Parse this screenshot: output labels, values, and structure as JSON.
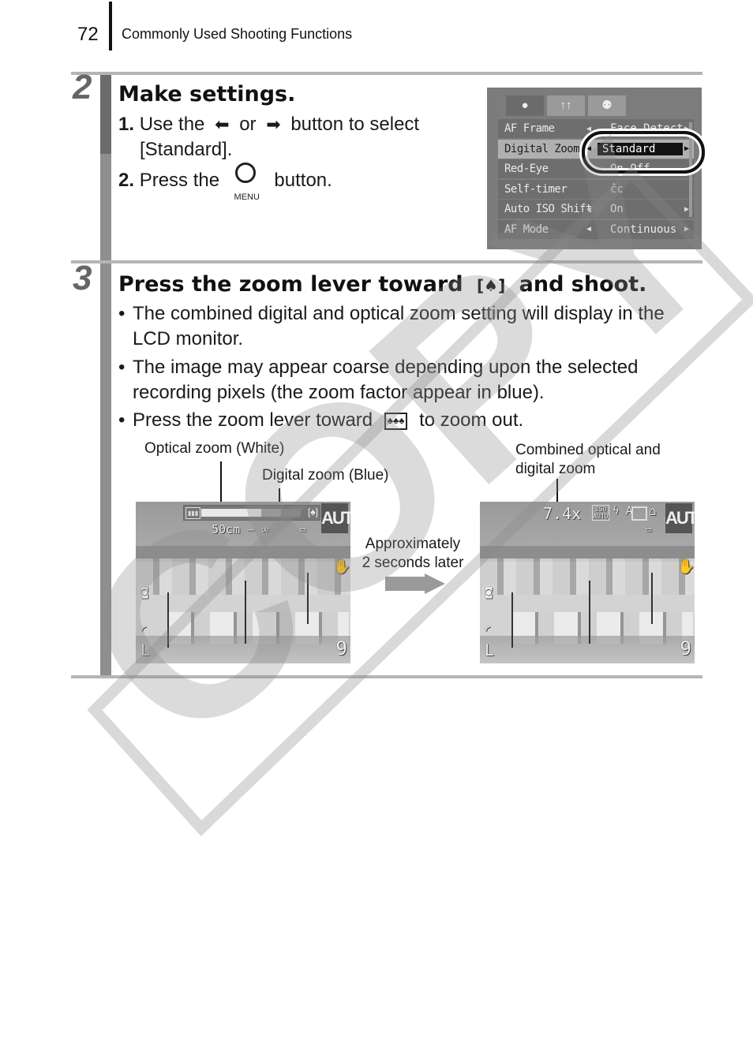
{
  "header": {
    "page_number": "72",
    "chapter_title": "Commonly Used Shooting Functions"
  },
  "step2": {
    "number": "2",
    "title": "Make settings.",
    "item1_num": "1.",
    "item1_pre": "Use the",
    "left_arrow_icon": "⬅",
    "item1_or": "or",
    "right_arrow_icon": "➡",
    "item1_post": "button to select",
    "item1_line2": "[Standard].",
    "item2_num": "2.",
    "item2_pre": "Press the",
    "menu_button_label": "MENU",
    "item2_post": "button."
  },
  "camera_menu": {
    "tabs": [
      {
        "icon": "camera-icon",
        "glyph": "●"
      },
      {
        "icon": "settings-icon",
        "glyph": "↑↑"
      },
      {
        "icon": "my-settings-icon",
        "glyph": "⚉"
      }
    ],
    "rows": [
      {
        "label": "AF Frame",
        "value": "Face Detect",
        "selected": false
      },
      {
        "label": "Digital Zoom",
        "value": "Standard",
        "selected": true
      },
      {
        "label": "Red-Eye",
        "value": "On Off",
        "selected": false
      },
      {
        "label": "Self-timer",
        "value": "ĉc",
        "selected": false
      },
      {
        "label": "Auto ISO Shift",
        "value": "On",
        "selected": false
      },
      {
        "label": "AF Mode",
        "value": "Continuous",
        "selected": false
      }
    ]
  },
  "step3": {
    "number": "3",
    "title_pre": "Press the zoom lever toward",
    "tele_icon": "[♠]",
    "title_post": "and shoot.",
    "bullets": [
      {
        "line1": "The combined digital and optical zoom setting will display in the",
        "line2": "LCD monitor."
      },
      {
        "line1": "The image may appear coarse depending upon the selected",
        "line2": "recording pixels (the zoom factor appear in blue)."
      },
      {
        "pre": "Press the zoom lever toward",
        "wide_icon": "♣♣♣",
        "post": "to zoom out."
      }
    ],
    "bullet_char": "•"
  },
  "figure": {
    "caption_optical": "Optical zoom (White)",
    "caption_digital": "Digital zoom (Blue)",
    "caption_combined_line1": "Combined optical and",
    "caption_combined_line2": "digital zoom",
    "transition_line1": "Approximately",
    "transition_line2": "2 seconds later",
    "left_screen": {
      "auto_label": "AUTO",
      "focus_distance": "50cm — ∞",
      "optical_zoom_fraction": 0.6,
      "digital_zoom_fraction": 0.2,
      "shots_remaining": "9",
      "size_label": "L"
    },
    "right_screen": {
      "auto_label": "AUTO",
      "zoom_factor": "7.4x",
      "iso_label": "ISO AUTO",
      "flash_label": "ϟ A",
      "shots_remaining": "9",
      "size_label": "L"
    }
  },
  "watermark": {
    "text": "COPY"
  }
}
